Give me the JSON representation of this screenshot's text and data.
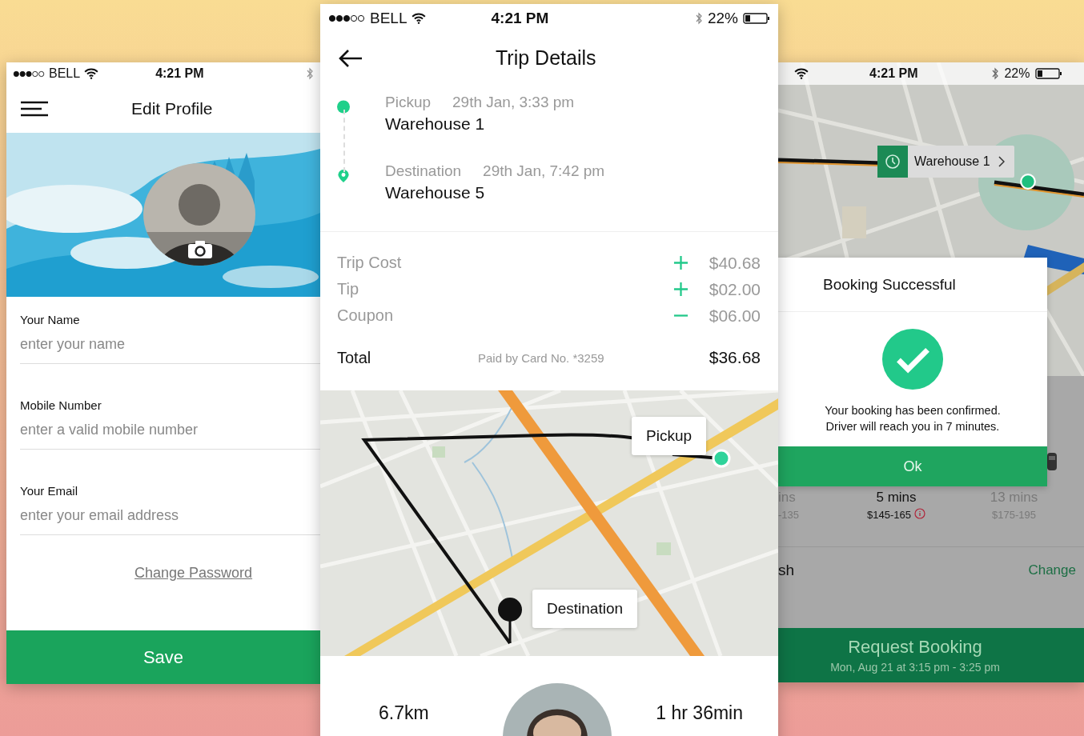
{
  "screens": {
    "edit_profile": {
      "status_bar": {
        "carrier": "BELL",
        "time": "4:21 PM"
      },
      "title": "Edit Profile",
      "fields": [
        {
          "label": "Your Name",
          "placeholder": "enter your name"
        },
        {
          "label": "Mobile Number",
          "placeholder": "enter a valid mobile number"
        },
        {
          "label": "Your Email",
          "placeholder": "enter your email address"
        }
      ],
      "link": "Change Password",
      "button": "Save"
    },
    "trip_details": {
      "status_bar": {
        "carrier": "BELL",
        "time": "4:21 PM",
        "battery": "22%"
      },
      "title": "Trip Details",
      "stops": [
        {
          "kind": "pickup",
          "label": "Pickup",
          "time": "29th Jan, 3:33 pm",
          "place": "Warehouse 1"
        },
        {
          "kind": "destination",
          "label": "Destination",
          "time": "29th Jan, 7:42 pm",
          "place": "Warehouse 5"
        }
      ],
      "charges": [
        {
          "label": "Trip Cost",
          "kind": "add",
          "amount": "$40.68"
        },
        {
          "label": "Tip",
          "kind": "add",
          "amount": "$02.00"
        },
        {
          "label": "Coupon",
          "kind": "subtract",
          "amount": "$06.00"
        }
      ],
      "total": {
        "label": "Total",
        "note": "Paid by Card No. *3259",
        "amount": "$36.68"
      },
      "map_labels": {
        "pickup": "Pickup",
        "destination": "Destination"
      },
      "distance": "6.7km",
      "duration": "1 hr 36min"
    },
    "booking": {
      "status_bar": {
        "time": "4:21 PM",
        "battery": "22%"
      },
      "map_callout": "Warehouse 1",
      "dialog": {
        "title": "Booking Successful",
        "lines": [
          "Your booking has been confirmed.",
          "Driver will reach you in 7 minutes."
        ],
        "button": "Ok"
      },
      "options": [
        {
          "eta": "ins",
          "price": "-135",
          "selected": false
        },
        {
          "eta": "5 mins",
          "price": "$145-165",
          "selected": true
        },
        {
          "eta": "13 mins",
          "price": "$175-195",
          "selected": false
        }
      ],
      "payment": "sh",
      "change": "Change",
      "request": {
        "label": "Request Booking",
        "subtitle": "Mon, Aug 21 at 3:15 pm - 3:25 pm"
      }
    }
  }
}
